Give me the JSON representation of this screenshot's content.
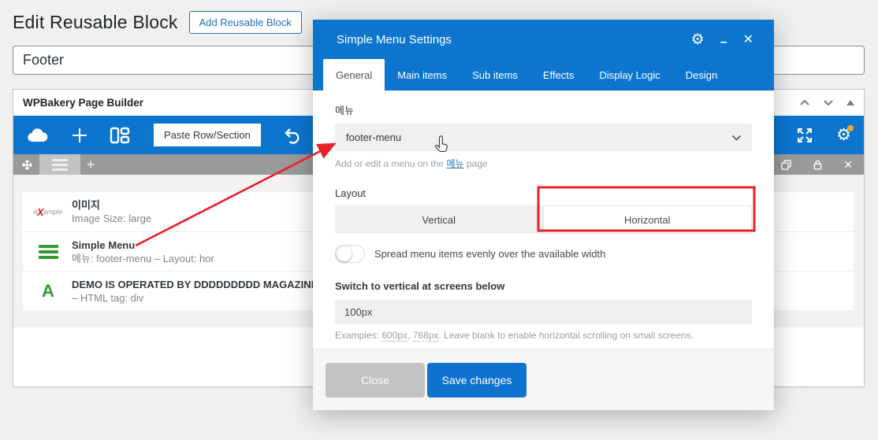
{
  "colors": {
    "accent_blue": "#0c76cf",
    "save_button_blue": "#0e72cf",
    "close_button_gray": "#c3c3c3",
    "toolbar_gray": "#9a9a9a",
    "icon_green": "#339933",
    "annotation_red": "#e8202a",
    "notification_dot_orange": "#f5a623",
    "link_blue": "#2271b1"
  },
  "glyphs": {
    "plus": "+",
    "gear": "⚙",
    "minimize": "–",
    "close": "✕",
    "delete_x": "✕"
  },
  "page": {
    "heading": "Edit Reusable Block",
    "add_button": "Add Reusable Block",
    "title_field_value": "Footer"
  },
  "builder": {
    "panel_title": "WPBakery Page Builder",
    "paste_button": "Paste Row/Section",
    "rows": [
      {
        "thumb": {
          "pre": "e",
          "x": "X",
          "post": "ample"
        },
        "title": "이미지",
        "subtitle": "Image Size: large"
      },
      {
        "title": "Simple Menu",
        "subtitle": "메뉴: footer-menu – Layout: hor"
      },
      {
        "icon_letter": "A",
        "title": "DEMO IS OPERATED BY DDDDDDDDD MAGAZINE",
        "subtitle": "– HTML tag: div"
      }
    ]
  },
  "modal": {
    "title": "Simple Menu Settings",
    "tabs": [
      "General",
      "Main items",
      "Sub items",
      "Effects",
      "Display Logic",
      "Design"
    ],
    "active_tab": "General",
    "menu_field": {
      "label": "메뉴",
      "value": "footer-menu",
      "help_prefix": "Add or edit a menu on the ",
      "help_link": "메뉴",
      "help_suffix": " page"
    },
    "layout_field": {
      "label": "Layout",
      "option_vertical": "Vertical",
      "option_horizontal": "Horizontal",
      "selected": "Horizontal"
    },
    "spread_toggle": {
      "label": "Spread menu items evenly over the available width",
      "state": "off"
    },
    "switch_field": {
      "label": "Switch to vertical at screens below",
      "value": "100px",
      "help_prefix": "Examples: ",
      "example1": "600px",
      "help_mid": ", ",
      "example2": "768px",
      "help_suffix": ". Leave blank to enable horizontal scrolling on small screens."
    },
    "footer": {
      "close_button": "Close",
      "save_button": "Save changes"
    }
  }
}
